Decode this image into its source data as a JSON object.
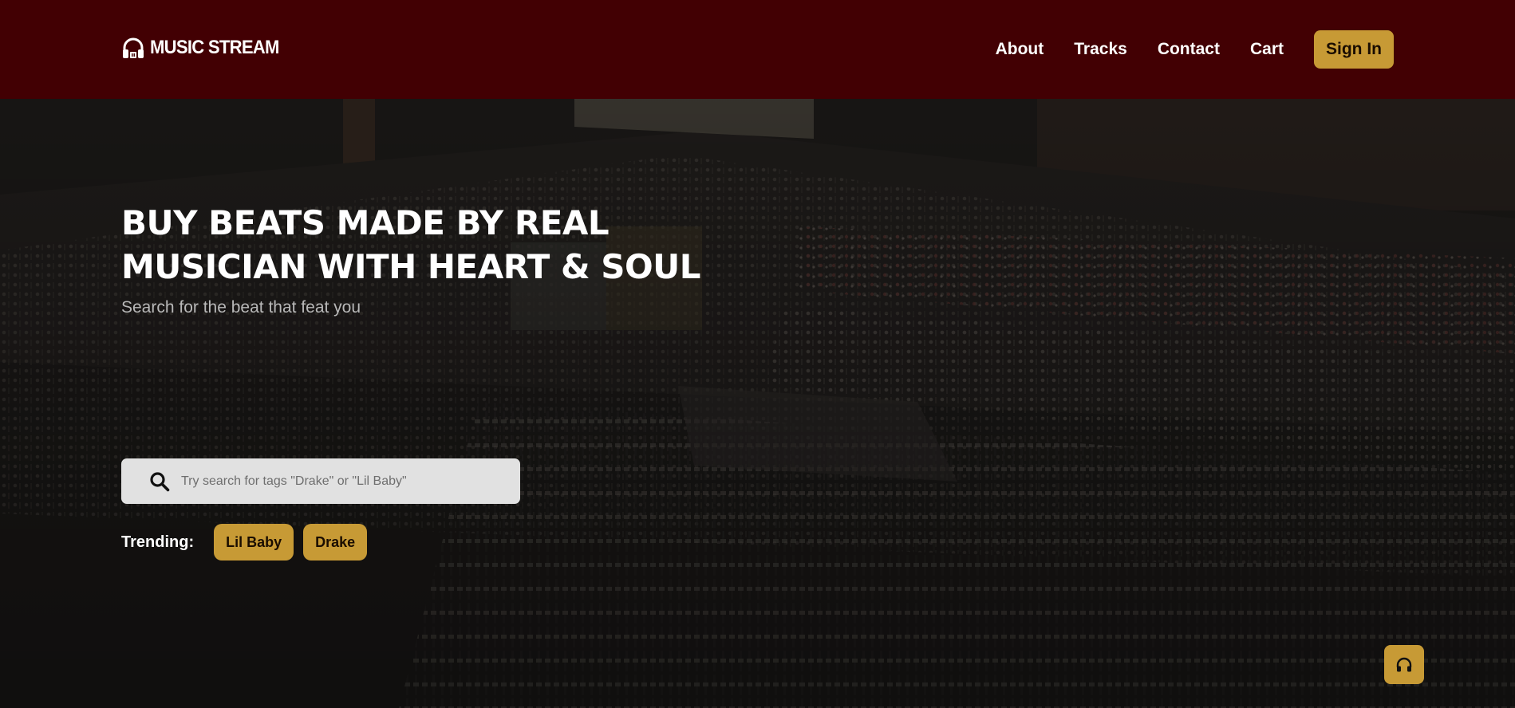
{
  "brand": {
    "name": "MUSIC STREAM",
    "icon": "headphones-icon"
  },
  "nav": {
    "links": [
      {
        "label": "About"
      },
      {
        "label": "Tracks"
      },
      {
        "label": "Contact"
      },
      {
        "label": "Cart"
      }
    ],
    "signin_label": "Sign In"
  },
  "hero": {
    "headline_line1": "BUY BEATS MADE BY REAL",
    "headline_line2": "MUSICIAN WITH HEART & SOUL",
    "subline": "Search for the beat that feat you",
    "background": "recording studio mixing console photo"
  },
  "search": {
    "placeholder": "Try search for tags \"Drake\" or \"Lil Baby\"",
    "value": "",
    "icon": "search-icon"
  },
  "trending": {
    "label": "Trending:",
    "tags": [
      {
        "label": "Lil Baby"
      },
      {
        "label": "Drake"
      }
    ]
  },
  "floating_button": {
    "icon": "headphones-icon"
  },
  "colors": {
    "navbar_bg": "#420003",
    "accent": "#c79a35",
    "hero_bg": "#1c1c1c",
    "search_bg": "#e1e1e1"
  }
}
